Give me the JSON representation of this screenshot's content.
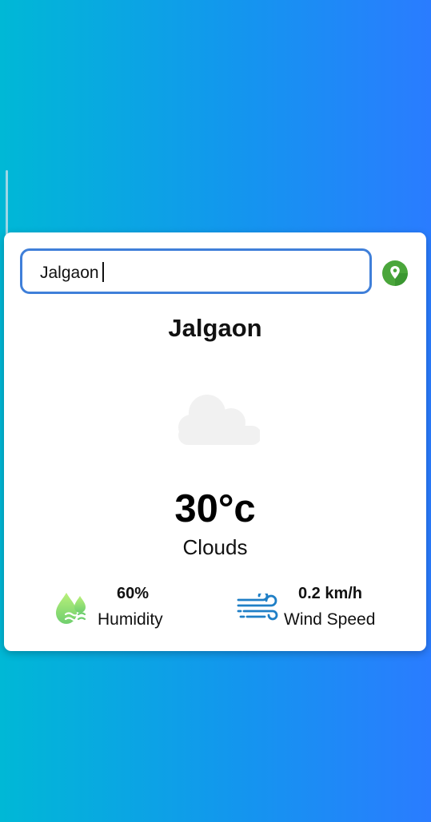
{
  "search": {
    "value": "Jalgaon",
    "focused": true
  },
  "location_button": {
    "icon": "map-pin-icon",
    "color": "#4aa63b"
  },
  "weather": {
    "city": "Jalgaon",
    "icon": "cloud-icon",
    "temperature": "30°c",
    "condition": "Clouds"
  },
  "stats": {
    "humidity": {
      "icon": "humidity-drops-icon",
      "value": "60%",
      "label": "Humidity"
    },
    "wind": {
      "icon": "wind-icon",
      "value": "0.2 km/h",
      "label": "Wind Speed"
    }
  },
  "colors": {
    "background_start": "#00b8d6",
    "background_end": "#2a7cff",
    "search_border": "#3f7fd9",
    "wind_icon": "#1f7fc6",
    "humidity_icon": "#8fe07a"
  }
}
